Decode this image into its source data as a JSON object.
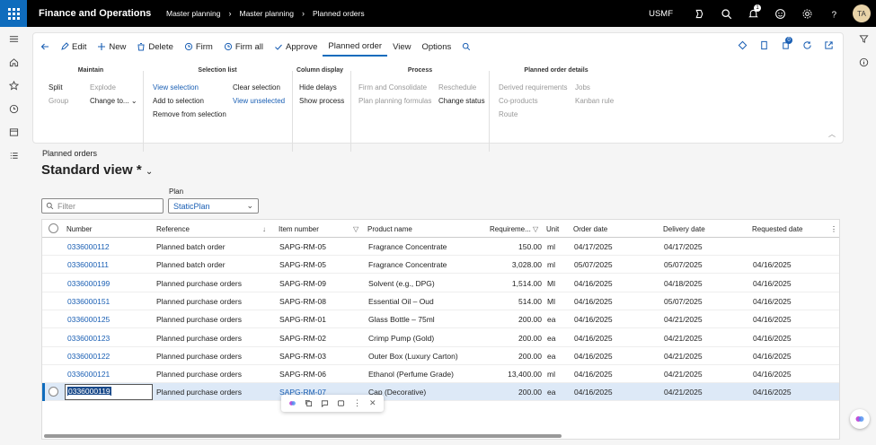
{
  "app": {
    "title": "Finance and Operations",
    "company": "USMF",
    "avatar": "TA",
    "notification_count": "1"
  },
  "breadcrumb": [
    "Master planning",
    "Master planning",
    "Planned orders"
  ],
  "actions": {
    "edit": "Edit",
    "new": "New",
    "delete": "Delete",
    "firm": "Firm",
    "firm_all": "Firm all",
    "approve": "Approve"
  },
  "tabs": {
    "active": "Planned order",
    "view": "View",
    "options": "Options"
  },
  "action_pane_badge": "0",
  "groups": {
    "maintain": {
      "title": "Maintain",
      "split": "Split",
      "group": "Group",
      "explode": "Explode",
      "change_to": "Change to..."
    },
    "selection": {
      "title": "Selection list",
      "view_selection": "View selection",
      "add_to_selection": "Add to selection",
      "remove_from_selection": "Remove from selection",
      "clear_selection": "Clear selection",
      "view_unselected": "View unselected"
    },
    "column_display": {
      "title": "Column display",
      "hide_delays": "Hide delays",
      "show_process": "Show process"
    },
    "process": {
      "title": "Process",
      "firm_consolidate": "Firm and Consolidate",
      "formulas": "Plan planning formulas",
      "reschedule": "Reschedule",
      "change_status": "Change status"
    },
    "details": {
      "title": "Planned order details",
      "derived": "Derived requirements",
      "coproducts": "Co-products",
      "route": "Route",
      "jobs": "Jobs",
      "kanban": "Kanban rule"
    }
  },
  "page": {
    "caption": "Planned orders",
    "view_title": "Standard view *",
    "filter_placeholder": "Filter",
    "plan_label": "Plan",
    "plan_value": "StaticPlan"
  },
  "columns": {
    "number": "Number",
    "reference": "Reference",
    "item": "Item number",
    "product": "Product name",
    "requirement": "Requireme...",
    "unit": "Unit",
    "order_date": "Order date",
    "delivery_date": "Delivery date",
    "requested_date": "Requested date"
  },
  "rows": [
    {
      "number": "0336000112",
      "reference": "Planned batch order",
      "item": "SAPG-RM-05",
      "product": "Fragrance Concentrate",
      "qty": "150.00",
      "unit": "ml",
      "order": "04/17/2025",
      "delivery": "04/17/2025",
      "requested": ""
    },
    {
      "number": "0336000111",
      "reference": "Planned batch order",
      "item": "SAPG-RM-05",
      "product": "Fragrance Concentrate",
      "qty": "3,028.00",
      "unit": "ml",
      "order": "05/07/2025",
      "delivery": "05/07/2025",
      "requested": "04/16/2025"
    },
    {
      "number": "0336000199",
      "reference": "Planned purchase orders",
      "item": "SAPG-RM-09",
      "product": "Solvent (e.g., DPG)",
      "qty": "1,514.00",
      "unit": "Ml",
      "order": "04/16/2025",
      "delivery": "04/18/2025",
      "requested": "04/16/2025"
    },
    {
      "number": "0336000151",
      "reference": "Planned purchase orders",
      "item": "SAPG-RM-08",
      "product": "Essential Oil – Oud",
      "qty": "514.00",
      "unit": "Ml",
      "order": "04/16/2025",
      "delivery": "05/07/2025",
      "requested": "04/16/2025"
    },
    {
      "number": "0336000125",
      "reference": "Planned purchase orders",
      "item": "SAPG-RM-01",
      "product": "Glass Bottle – 75ml",
      "qty": "200.00",
      "unit": "ea",
      "order": "04/16/2025",
      "delivery": "04/21/2025",
      "requested": "04/16/2025"
    },
    {
      "number": "0336000123",
      "reference": "Planned purchase orders",
      "item": "SAPG-RM-02",
      "product": "Crimp Pump (Gold)",
      "qty": "200.00",
      "unit": "ea",
      "order": "04/16/2025",
      "delivery": "04/21/2025",
      "requested": "04/16/2025"
    },
    {
      "number": "0336000122",
      "reference": "Planned purchase orders",
      "item": "SAPG-RM-03",
      "product": "Outer Box (Luxury Carton)",
      "qty": "200.00",
      "unit": "ea",
      "order": "04/16/2025",
      "delivery": "04/21/2025",
      "requested": "04/16/2025"
    },
    {
      "number": "0336000121",
      "reference": "Planned purchase orders",
      "item": "SAPG-RM-06",
      "product": "Ethanol (Perfume Grade)",
      "qty": "13,400.00",
      "unit": "ml",
      "order": "04/16/2025",
      "delivery": "04/21/2025",
      "requested": "04/16/2025"
    },
    {
      "number": "0336000119",
      "reference": "Planned purchase orders",
      "item": "SAPG-RM-07",
      "product": "Cap (Decorative)",
      "qty": "200.00",
      "unit": "ea",
      "order": "04/16/2025",
      "delivery": "04/21/2025",
      "requested": "04/16/2025"
    }
  ],
  "colors": {
    "accent": "#0f6cbd",
    "link": "#1a5fb4",
    "selected_row": "#dde9f7"
  }
}
